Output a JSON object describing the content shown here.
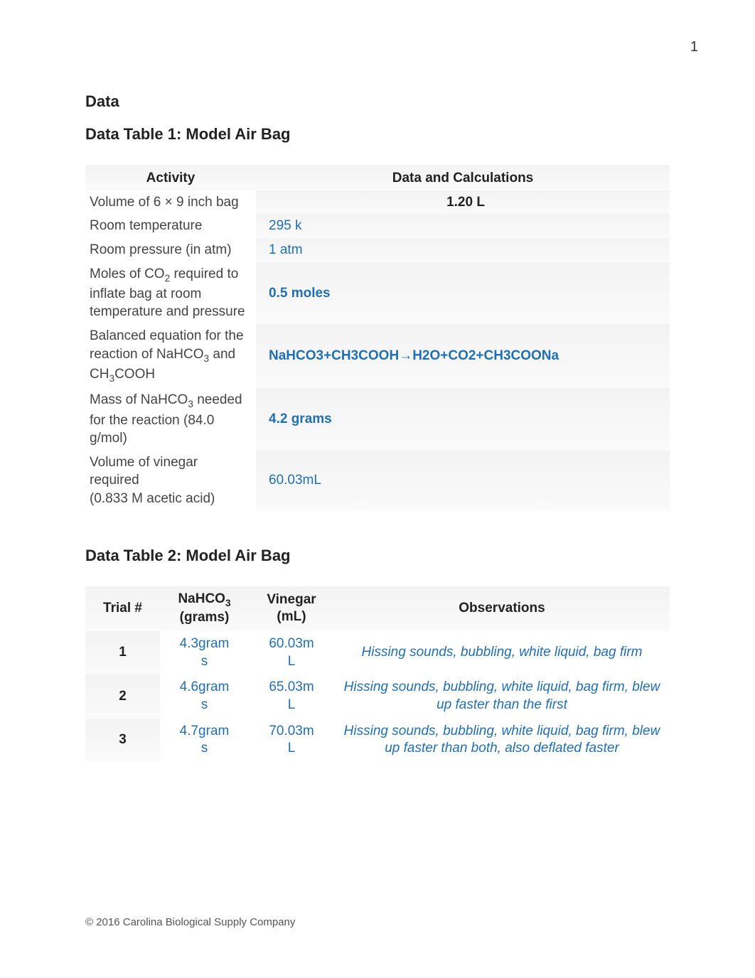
{
  "page_number": "1",
  "section_heading": "Data",
  "table1": {
    "title": "Data Table 1: Model Air Bag",
    "head_activity": "Activity",
    "head_data": "Data and Calculations",
    "rows": [
      {
        "label": "Volume of 6 × 9 inch bag",
        "value": "1.20 L",
        "style": "bold-black",
        "center": true
      },
      {
        "label": "Room temperature",
        "value": "295 k",
        "style": "blue"
      },
      {
        "label": "Room pressure (in atm)",
        "value": "1 atm",
        "style": "blue"
      },
      {
        "label": "Moles of CO₂ required to inflate bag at room temperature and pressure",
        "value": "0.5 moles",
        "style": "bold-blue"
      },
      {
        "label": "Balanced equation for the reaction of NaHCO₃ and CH₃COOH",
        "value": "NaHCO3+CH3COOH→H2O+CO2+CH3COONa",
        "style": "bold-blue"
      },
      {
        "label": "Mass of NaHCO₃ needed for the reaction (84.0 g/mol)",
        "value": "4.2 grams",
        "style": "bold-blue"
      },
      {
        "label": "Volume of vinegar required\n(0.833 M acetic acid)",
        "value": "60.03mL",
        "style": "blue"
      }
    ]
  },
  "table2": {
    "title": "Data Table 2: Model Air Bag",
    "head_trial": "Trial #",
    "head_nahco3": "NaHCO₃ (grams)",
    "head_vinegar": "Vinegar (mL)",
    "head_obs": "Observations",
    "rows": [
      {
        "trial": "1",
        "nahco3": "4.3grams",
        "vinegar": "60.03mL",
        "obs": "Hissing sounds, bubbling, white liquid, bag firm"
      },
      {
        "trial": "2",
        "nahco3": "4.6grams",
        "vinegar": "65.03mL",
        "obs": "Hissing sounds, bubbling, white liquid, bag firm, blew up faster than the first"
      },
      {
        "trial": "3",
        "nahco3": "4.7grams",
        "vinegar": "70.03mL",
        "obs": "Hissing sounds, bubbling, white liquid, bag firm, blew up faster than both, also deflated faster"
      }
    ]
  },
  "footer": "© 2016 Carolina Biological Supply Company",
  "chart_data": [
    {
      "type": "table",
      "title": "Data Table 1: Model Air Bag",
      "columns": [
        "Activity",
        "Data and Calculations"
      ],
      "rows": [
        [
          "Volume of 6 × 9 inch bag",
          "1.20 L"
        ],
        [
          "Room temperature",
          "295 k"
        ],
        [
          "Room pressure (in atm)",
          "1 atm"
        ],
        [
          "Moles of CO2 required to inflate bag at room temperature and pressure",
          "0.5 moles"
        ],
        [
          "Balanced equation for the reaction of NaHCO3 and CH3COOH",
          "NaHCO3+CH3COOH→H2O+CO2+CH3COONa"
        ],
        [
          "Mass of NaHCO3 needed for the reaction (84.0 g/mol)",
          "4.2 grams"
        ],
        [
          "Volume of vinegar required (0.833 M acetic acid)",
          "60.03mL"
        ]
      ]
    },
    {
      "type": "table",
      "title": "Data Table 2: Model Air Bag",
      "columns": [
        "Trial #",
        "NaHCO3 (grams)",
        "Vinegar (mL)",
        "Observations"
      ],
      "rows": [
        [
          "1",
          "4.3grams",
          "60.03mL",
          "Hissing sounds, bubbling, white liquid, bag firm"
        ],
        [
          "2",
          "4.6grams",
          "65.03mL",
          "Hissing sounds, bubbling, white liquid, bag firm, blew up faster than the first"
        ],
        [
          "3",
          "4.7grams",
          "70.03mL",
          "Hissing sounds, bubbling, white liquid, bag firm, blew up faster than both, also deflated faster"
        ]
      ]
    }
  ]
}
